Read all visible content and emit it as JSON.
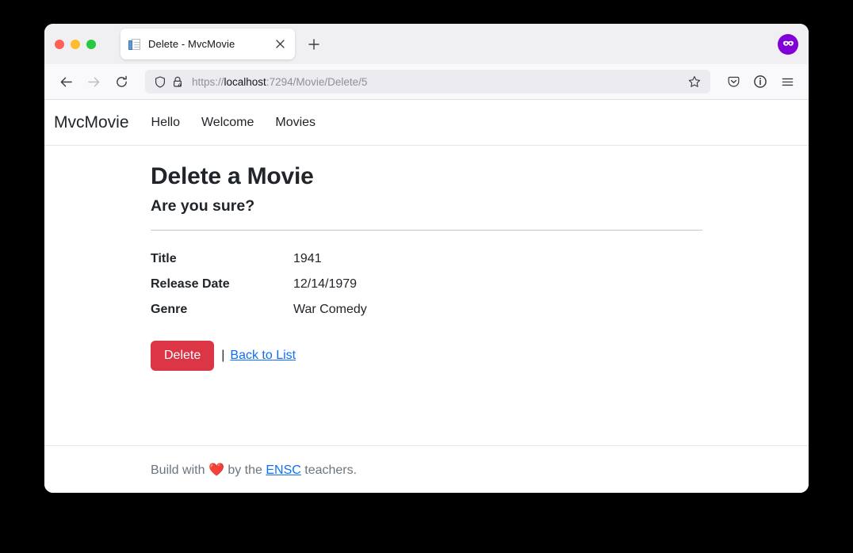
{
  "browser": {
    "tab": {
      "title": "Delete - MvcMovie",
      "favicon_icon": "page-document-icon",
      "close_icon": "close-icon"
    },
    "new_tab_icon": "plus-icon",
    "private_badge_icon": "private-mask-icon",
    "toolbar": {
      "back_icon": "back-arrow-icon",
      "forward_icon": "forward-arrow-icon",
      "reload_icon": "reload-icon",
      "shield_icon": "shield-icon",
      "lock_warning_icon": "lock-warning-icon",
      "url_scheme": "https://",
      "url_host": "localhost",
      "url_path": ":7294/Movie/Delete/5",
      "url_full": "https://localhost:7294/Movie/Delete/5",
      "bookmark_icon": "star-icon",
      "pocket_icon": "pocket-icon",
      "account_icon": "account-info-icon",
      "menu_icon": "hamburger-menu-icon"
    },
    "window_controls": {
      "close": "close-window",
      "minimize": "minimize-window",
      "maximize": "maximize-window"
    }
  },
  "site": {
    "brand": "MvcMovie",
    "nav_links": [
      {
        "label": "Hello"
      },
      {
        "label": "Welcome"
      },
      {
        "label": "Movies"
      }
    ]
  },
  "main": {
    "title": "Delete a Movie",
    "confirm": "Are you sure?",
    "details": [
      {
        "label": "Title",
        "value": "1941"
      },
      {
        "label": "Release Date",
        "value": "12/14/1979"
      },
      {
        "label": "Genre",
        "value": "War Comedy"
      }
    ],
    "delete_button": "Delete",
    "separator": "|",
    "back_link": "Back to List"
  },
  "footer": {
    "prefix": "Build with",
    "heart": "❤️",
    "middle": "by the",
    "link": "ENSC",
    "suffix": "teachers."
  },
  "colors": {
    "danger": "#dc3545",
    "link": "#0d6efd",
    "private": "#8000d7",
    "text": "#212529",
    "muted": "#6c757d"
  }
}
